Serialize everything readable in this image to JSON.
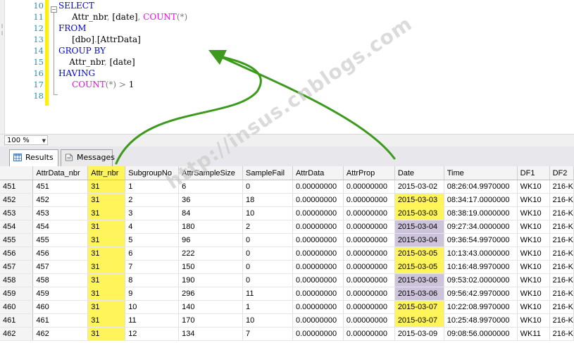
{
  "editor": {
    "line_numbers": [
      "10",
      "11",
      "12",
      "13",
      "14",
      "15",
      "16",
      "17",
      "18"
    ],
    "lines": [
      [
        {
          "t": "SELECT",
          "c": "kw"
        }
      ],
      [
        {
          "t": "     Attr_nbr",
          "c": ""
        },
        {
          "t": ",",
          "c": "gr"
        },
        {
          "t": " [date]",
          "c": ""
        },
        {
          "t": ",",
          "c": "gr"
        },
        {
          "t": " ",
          "c": ""
        },
        {
          "t": "COUNT",
          "c": "fn"
        },
        {
          "t": "(*)",
          "c": "gr"
        }
      ],
      [
        {
          "t": "FROM",
          "c": "kw"
        }
      ],
      [
        {
          "t": "     [dbo]",
          "c": ""
        },
        {
          "t": ".",
          "c": "gr"
        },
        {
          "t": "[AttrData]",
          "c": ""
        }
      ],
      [
        {
          "t": "GROUP BY",
          "c": "kw"
        }
      ],
      [
        {
          "t": "    Attr_nbr",
          "c": ""
        },
        {
          "t": ",",
          "c": "gr"
        },
        {
          "t": " [date]",
          "c": ""
        }
      ],
      [
        {
          "t": "HAVING",
          "c": "kw"
        }
      ],
      [
        {
          "t": "     ",
          "c": ""
        },
        {
          "t": "COUNT",
          "c": "fn"
        },
        {
          "t": "(*)",
          "c": "gr"
        },
        {
          "t": " > ",
          "c": "gr"
        },
        {
          "t": "1",
          "c": ""
        }
      ],
      []
    ]
  },
  "zoom": {
    "value": "100 %"
  },
  "tabs": {
    "results": "Results",
    "messages": "Messages"
  },
  "grid": {
    "columns": [
      "",
      "AttrData_nbr",
      "Attr_nbr",
      "SubgroupNo",
      "AttrSampleSize",
      "SampleFail",
      "AttrData",
      "AttrProp",
      "Date",
      "Time",
      "DF1",
      "DF2"
    ],
    "rows": [
      {
        "cells": [
          "451",
          "451",
          "31",
          "1",
          "6",
          "0",
          "0.00000000",
          "0.00000000",
          "2015-03-02",
          "08:26:04.9970000",
          "WK10",
          "216-K"
        ],
        "date_hl": ""
      },
      {
        "cells": [
          "452",
          "452",
          "31",
          "2",
          "36",
          "18",
          "0.00000000",
          "0.00000000",
          "2015-03-03",
          "08:34:17.0000000",
          "WK10",
          "216-K"
        ],
        "date_hl": "yellow"
      },
      {
        "cells": [
          "453",
          "453",
          "31",
          "3",
          "84",
          "10",
          "0.00000000",
          "0.00000000",
          "2015-03-03",
          "08:38:19.0000000",
          "WK10",
          "216-K"
        ],
        "date_hl": "yellow"
      },
      {
        "cells": [
          "454",
          "454",
          "31",
          "4",
          "180",
          "2",
          "0.00000000",
          "0.00000000",
          "2015-03-04",
          "09:27:34.0000000",
          "WK10",
          "216-K"
        ],
        "date_hl": "purple"
      },
      {
        "cells": [
          "455",
          "455",
          "31",
          "5",
          "96",
          "0",
          "0.00000000",
          "0.00000000",
          "2015-03-04",
          "09:36:54.9970000",
          "WK10",
          "216-K"
        ],
        "date_hl": "purple"
      },
      {
        "cells": [
          "456",
          "456",
          "31",
          "6",
          "222",
          "0",
          "0.00000000",
          "0.00000000",
          "2015-03-05",
          "10:13:43.0000000",
          "WK10",
          "216-K"
        ],
        "date_hl": "yellow"
      },
      {
        "cells": [
          "457",
          "457",
          "31",
          "7",
          "150",
          "0",
          "0.00000000",
          "0.00000000",
          "2015-03-05",
          "10:16:48.9970000",
          "WK10",
          "216-K"
        ],
        "date_hl": "yellow"
      },
      {
        "cells": [
          "458",
          "458",
          "31",
          "8",
          "190",
          "0",
          "0.00000000",
          "0.00000000",
          "2015-03-06",
          "09:53:02.0000000",
          "WK10",
          "216-K"
        ],
        "date_hl": "purple"
      },
      {
        "cells": [
          "459",
          "459",
          "31",
          "9",
          "296",
          "11",
          "0.00000000",
          "0.00000000",
          "2015-03-06",
          "09:56:42.9970000",
          "WK10",
          "216-K"
        ],
        "date_hl": "purple"
      },
      {
        "cells": [
          "460",
          "460",
          "31",
          "10",
          "140",
          "1",
          "0.00000000",
          "0.00000000",
          "2015-03-07",
          "10:22:08.9970000",
          "WK10",
          "216-K"
        ],
        "date_hl": "yellow"
      },
      {
        "cells": [
          "461",
          "461",
          "31",
          "11",
          "170",
          "10",
          "0.00000000",
          "0.00000000",
          "2015-03-07",
          "10:25:48.9970000",
          "WK10",
          "216-K"
        ],
        "date_hl": "yellow"
      },
      {
        "cells": [
          "462",
          "462",
          "31",
          "12",
          "134",
          "7",
          "0.00000000",
          "0.00000000",
          "2015-03-09",
          "09:08:56.0000000",
          "WK11",
          "216-K"
        ],
        "date_hl": ""
      }
    ]
  },
  "watermark": "http://insus.cnblogs.com",
  "colors": {
    "highlight_yellow": "#fff45a",
    "highlight_purple": "#cdc4dc",
    "arrow_green": "#3c9a1c"
  }
}
